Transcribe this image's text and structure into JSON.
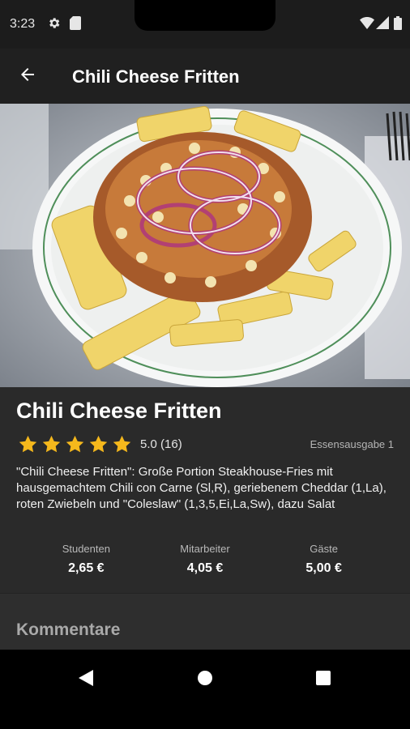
{
  "status_bar": {
    "time": "3:23",
    "left_icons": [
      "gear-icon",
      "sd-card-icon"
    ],
    "right_icons": [
      "wifi-icon",
      "signal-icon",
      "battery-icon"
    ]
  },
  "app_bar": {
    "title": "Chili Cheese Fritten",
    "back_icon": "arrow-left-icon"
  },
  "dish": {
    "photo_icon": "dish-photo",
    "name": "Chili Cheese Fritten",
    "rating": 5.0,
    "rating_text": "5.0 (16)",
    "stars_total": 5,
    "location": "Essensausgabe 1",
    "description": "\"Chili Cheese Fritten\": Große Portion Steakhouse-Fries mit hausgemachtem Chili con Carne (Sl,R), geriebenem Cheddar (1,La), roten Zwiebeln und \"Coleslaw\" (1,3,5,Ei,La,Sw), dazu Salat",
    "prices": [
      {
        "label": "Studenten",
        "value": "2,65 €"
      },
      {
        "label": "Mitarbeiter",
        "value": "4,05 €"
      },
      {
        "label": "Gäste",
        "value": "5,00 €"
      }
    ]
  },
  "comments": {
    "heading": "Kommentare"
  },
  "nav_bar": {
    "icons": [
      "back-triangle-icon",
      "home-circle-icon",
      "recents-square-icon"
    ]
  },
  "colors": {
    "star": "#f5b81c",
    "surface": "#2a2a2a",
    "app_bar": "#202020"
  }
}
